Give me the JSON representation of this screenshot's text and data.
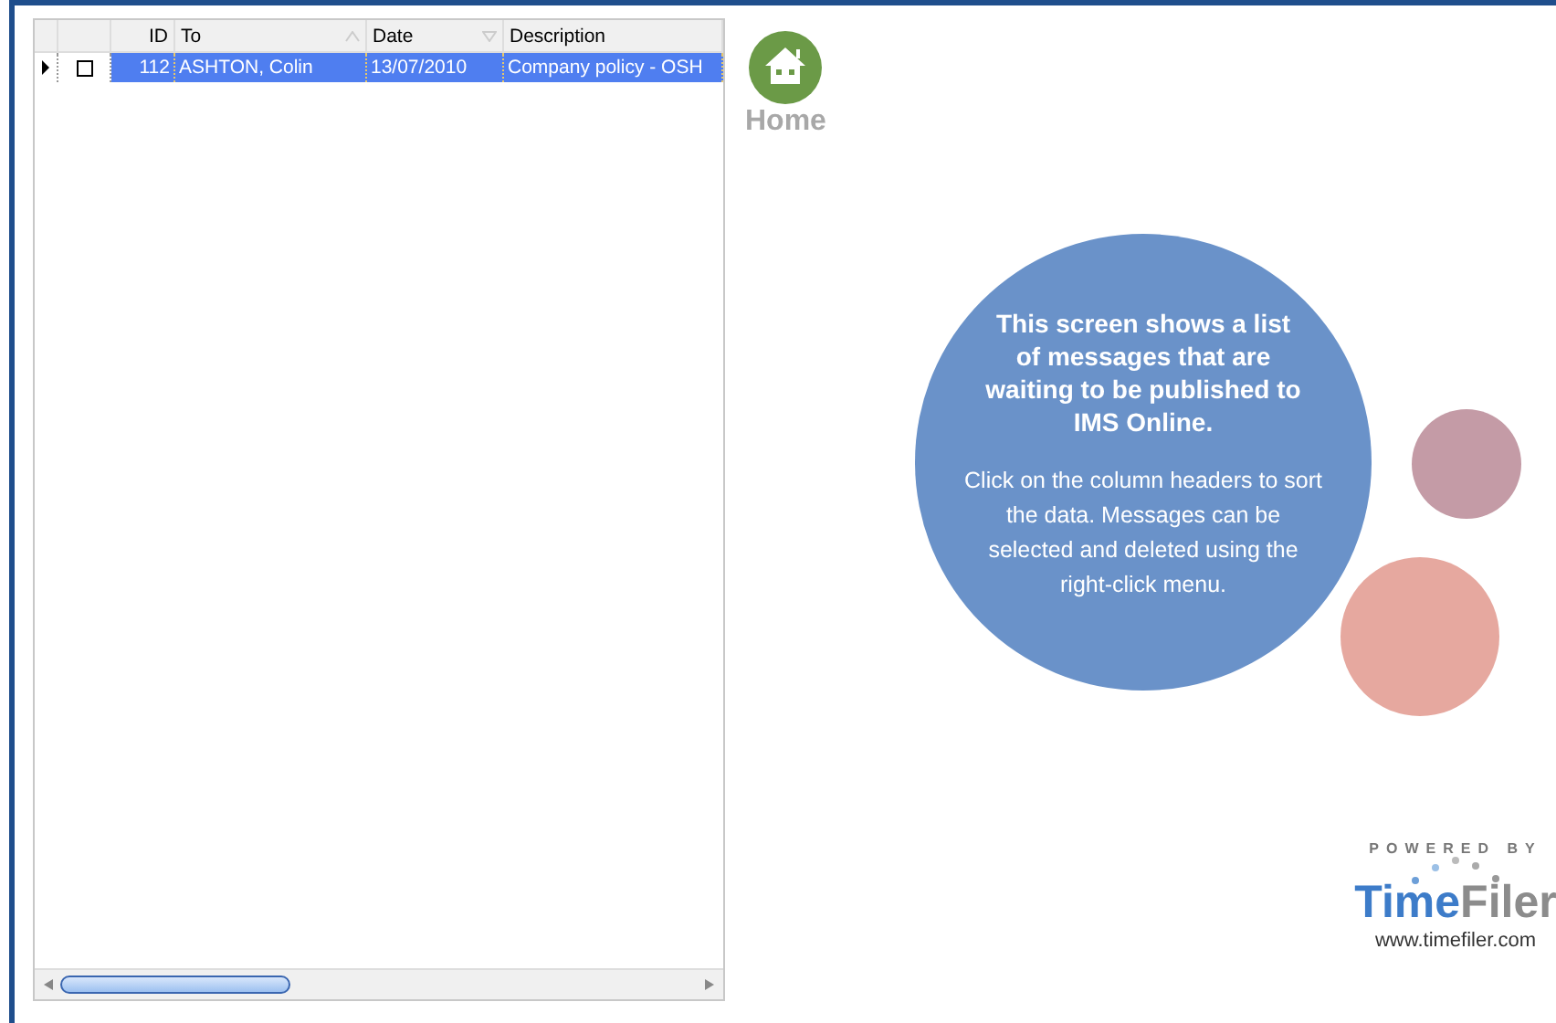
{
  "grid": {
    "columns": [
      {
        "label": "ID",
        "sort_ascending": false,
        "sort_descending": false
      },
      {
        "label": "To",
        "sort_ascending": true,
        "sort_descending": false
      },
      {
        "label": "Date",
        "sort_ascending": false,
        "sort_descending": true
      },
      {
        "label": "Description",
        "sort_ascending": false,
        "sort_descending": false
      }
    ],
    "rows": [
      {
        "id": "112",
        "to": "ASHTON, Colin",
        "date": "13/07/2010",
        "description": "Company policy - OSH",
        "selected": true,
        "checked": false,
        "current": true
      }
    ]
  },
  "home": {
    "label": "Home"
  },
  "info": {
    "heading": "This screen shows a list of messages that are waiting to be published to IMS Online.",
    "body": "Click on the column headers to sort the data.  Messages can be selected and deleted using the right-click menu."
  },
  "brand": {
    "powered_by": "POWERED BY",
    "name_primary": "Time",
    "name_secondary": "Filer",
    "url": "www.timefiler.com"
  }
}
